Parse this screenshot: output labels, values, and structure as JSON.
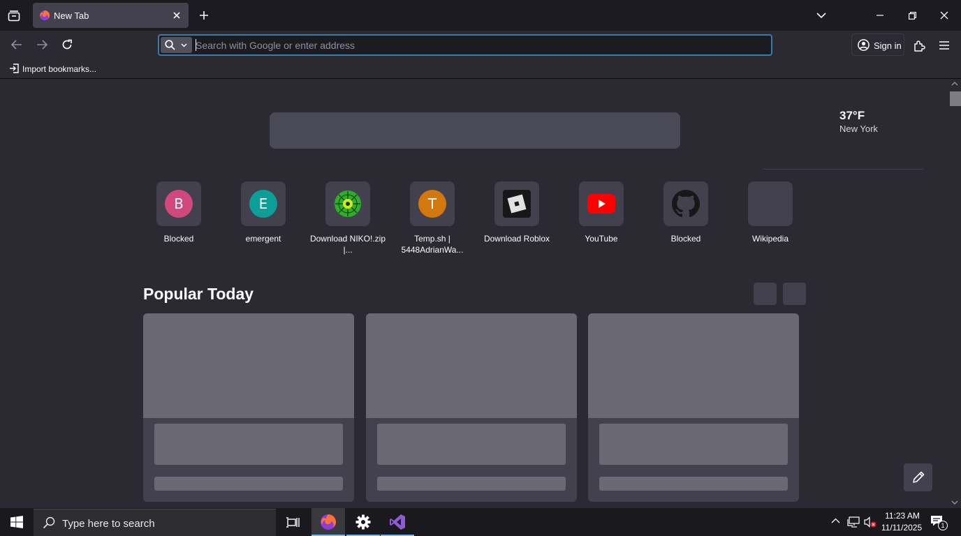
{
  "browser": {
    "tab": {
      "title": "New Tab"
    },
    "urlbar": {
      "placeholder": "Search with Google or enter address"
    },
    "account": {
      "sign_in_label": "Sign in"
    },
    "bookmarks": {
      "import_label": "Import bookmarks..."
    }
  },
  "newtab": {
    "weather": {
      "temperature": "37°F",
      "city": "New York"
    },
    "top_sites": [
      {
        "label": "Blocked",
        "icon": "letter-b-icon",
        "letter": "B",
        "color": "#d0487c"
      },
      {
        "label": "emergent",
        "icon": "letter-e-icon",
        "letter": "E",
        "color": "#0d9e99"
      },
      {
        "label": "Download NIKO!.zip |...",
        "icon": "limewire-icon"
      },
      {
        "label": "Temp.sh | 5448AdrianWa...",
        "icon": "letter-t-icon",
        "letter": "T",
        "color": "#d3780f"
      },
      {
        "label": "Download Roblox",
        "icon": "roblox-icon"
      },
      {
        "label": "YouTube",
        "icon": "youtube-icon",
        "color": "#ff0000"
      },
      {
        "label": "Blocked",
        "icon": "github-icon"
      },
      {
        "label": "Wikipedia",
        "icon": "blank-tile-icon"
      }
    ],
    "popular": {
      "title": "Popular Today"
    }
  },
  "taskbar": {
    "search_label": "Type here to search",
    "clock": {
      "time": "11:23 AM",
      "date": "11/11/2025"
    },
    "notification_count": "1",
    "apps": [
      "firefox-icon",
      "settings-icon",
      "visual-studio-icon"
    ]
  },
  "colors": {
    "accent": "#3a7ba8",
    "chrome": "#1c1b22",
    "page": "#2b2a33"
  }
}
